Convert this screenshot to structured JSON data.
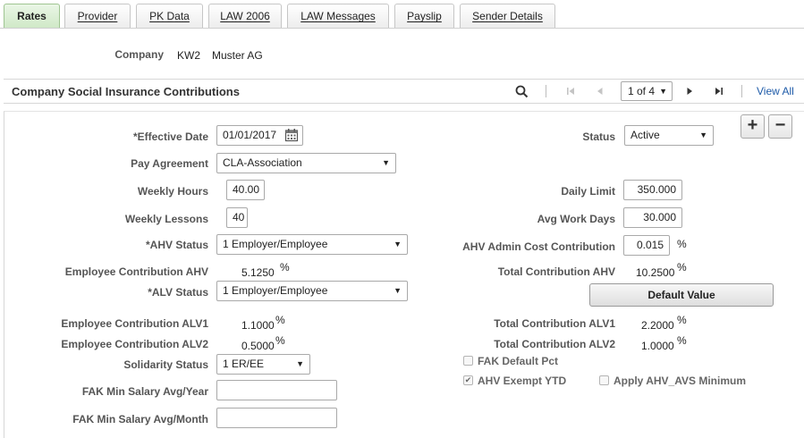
{
  "tabs": [
    {
      "label": "Rates"
    },
    {
      "label": "Provider"
    },
    {
      "label": "PK Data"
    },
    {
      "label": "LAW 2006"
    },
    {
      "label": "LAW Messages"
    },
    {
      "label": "Payslip"
    },
    {
      "label": "Sender Details"
    }
  ],
  "company": {
    "label": "Company",
    "code": "KW2",
    "name": "Muster AG"
  },
  "section": {
    "title": "Company Social Insurance Contributions",
    "pager": "1 of 4",
    "view_all": "View All"
  },
  "form": {
    "effective_date": {
      "label": "*Effective Date",
      "value": "01/01/2017"
    },
    "status": {
      "label": "Status",
      "value": "Active"
    },
    "pay_agreement": {
      "label": "Pay Agreement",
      "value": "CLA-Association"
    },
    "weekly_hours": {
      "label": "Weekly Hours",
      "value": "40.00"
    },
    "daily_limit": {
      "label": "Daily Limit",
      "value": "350.000"
    },
    "weekly_lessons": {
      "label": "Weekly Lessons",
      "value": "40"
    },
    "avg_work_days": {
      "label": "Avg Work Days",
      "value": "30.000"
    },
    "ahv_status": {
      "label": "*AHV Status",
      "value": "1 Employer/Employee"
    },
    "ahv_admin_cost": {
      "label": "AHV Admin Cost Contribution",
      "value": "0.015",
      "unit": "%"
    },
    "emp_contrib_ahv": {
      "label": "Employee Contribution AHV",
      "value": "5.1250",
      "unit": "%"
    },
    "total_contrib_ahv": {
      "label": "Total Contribution AHV",
      "value": "10.2500",
      "unit": "%"
    },
    "alv_status": {
      "label": "*ALV Status",
      "value": "1 Employer/Employee"
    },
    "default_value_button": "Default Value",
    "emp_contrib_alv1": {
      "label": "Employee Contribution ALV1",
      "value": "1.1000",
      "unit": "%"
    },
    "total_contrib_alv1": {
      "label": "Total Contribution ALV1",
      "value": "2.2000",
      "unit": "%"
    },
    "emp_contrib_alv2": {
      "label": "Employee Contribution ALV2",
      "value": "0.5000",
      "unit": "%"
    },
    "total_contrib_alv2": {
      "label": "Total Contribution ALV2",
      "value": "1.0000",
      "unit": "%"
    },
    "solidarity_status": {
      "label": "Solidarity Status",
      "value": "1 ER/EE"
    },
    "fak_default_pct": {
      "label": "FAK Default Pct",
      "checked": false
    },
    "ahv_exempt_ytd": {
      "label": "AHV Exempt YTD",
      "checked": true
    },
    "apply_ahv_avs_min": {
      "label": "Apply AHV_AVS Minimum",
      "checked": false
    },
    "fak_min_salary_year": {
      "label": "FAK Min Salary Avg/Year",
      "value": ""
    },
    "fak_min_salary_month": {
      "label": "FAK Min Salary Avg/Month",
      "value": ""
    }
  },
  "colors": {
    "active_tab": "#cfe8c6",
    "link": "#1d5aa8"
  }
}
